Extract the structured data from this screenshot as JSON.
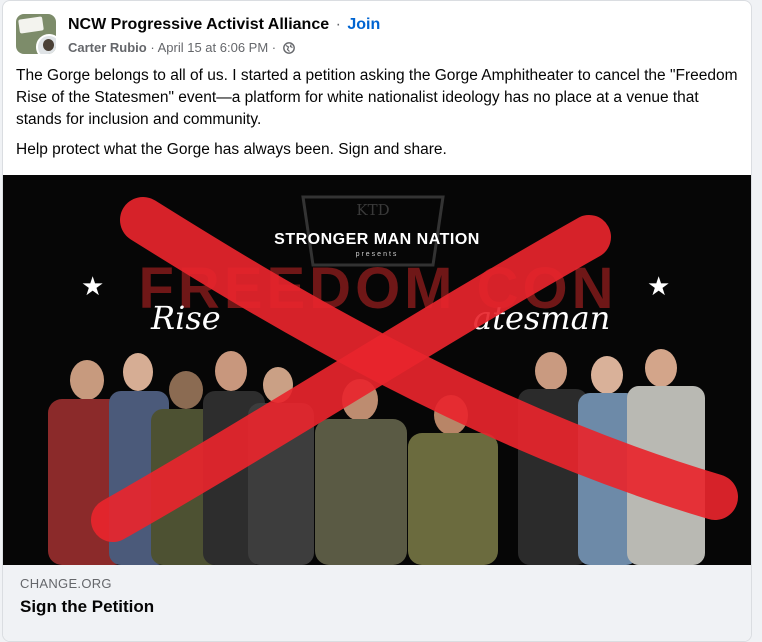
{
  "post": {
    "group_name": "NCW Progressive Activist Alliance",
    "separator": "·",
    "join_label": "Join",
    "author": "Carter Rubio",
    "timestamp": "April 15 at 6:06 PM",
    "audience_icon": "globe-icon",
    "text_paragraph_1": "The Gorge belongs to all of us. I started a petition asking the Gorge Amphitheater to cancel the \"Freedom Rise of the Statesmen\" event—a platform for white nationalist ideology has no place at a venue that stands for inclusion and community.",
    "text_paragraph_2": "Help protect what the Gorge has always been. Sign and share."
  },
  "image": {
    "logo_text": "KTD",
    "presenter": "STRONGER MAN NATION",
    "presents": "presents",
    "big_word": "FREEDOM CON",
    "script_left": "Rise",
    "script_right": "atesman",
    "overlay_color": "#e8252c"
  },
  "link_preview": {
    "source": "CHANGE.ORG",
    "title": "Sign the Petition"
  },
  "colors": {
    "link": "#0064d1",
    "text": "#050505",
    "muted": "#65676b",
    "preview_bg": "#f0f2f5"
  }
}
